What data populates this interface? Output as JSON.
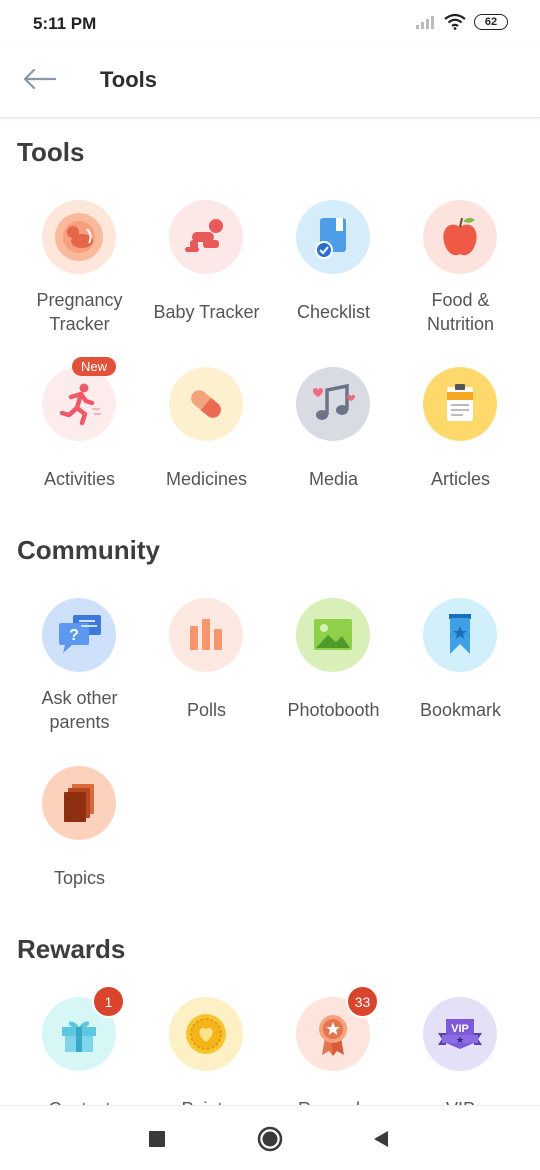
{
  "status": {
    "time": "5:11 PM",
    "battery": "62"
  },
  "header": {
    "title": "Tools"
  },
  "sections": {
    "tools": {
      "title": "Tools",
      "items": [
        {
          "label": "Pregnancy Tracker",
          "icon": "pregnancy-icon"
        },
        {
          "label": "Baby Tracker",
          "icon": "baby-icon"
        },
        {
          "label": "Checklist",
          "icon": "checklist-icon"
        },
        {
          "label": "Food & Nutrition",
          "icon": "apple-icon"
        },
        {
          "label": "Activities",
          "icon": "running-icon",
          "badge": "New"
        },
        {
          "label": "Medicines",
          "icon": "pill-icon"
        },
        {
          "label": "Media",
          "icon": "music-icon"
        },
        {
          "label": "Articles",
          "icon": "clipboard-icon"
        }
      ]
    },
    "community": {
      "title": "Community",
      "items": [
        {
          "label": "Ask other parents",
          "icon": "chat-icon"
        },
        {
          "label": "Polls",
          "icon": "bar-chart-icon"
        },
        {
          "label": "Photobooth",
          "icon": "image-icon"
        },
        {
          "label": "Bookmark",
          "icon": "bookmark-icon"
        },
        {
          "label": "Topics",
          "icon": "book-icon"
        }
      ]
    },
    "rewards": {
      "title": "Rewards",
      "items": [
        {
          "label": "Contest",
          "icon": "gift-icon",
          "badge": "1"
        },
        {
          "label": "Points",
          "icon": "coin-icon"
        },
        {
          "label": "Rewards",
          "icon": "medal-icon",
          "badge": "33"
        },
        {
          "label": "VIP Membership",
          "icon": "vip-icon"
        }
      ]
    }
  },
  "colors": {
    "accent": "#e2513a",
    "section_title": "#3d3d3d",
    "label": "#555555"
  }
}
